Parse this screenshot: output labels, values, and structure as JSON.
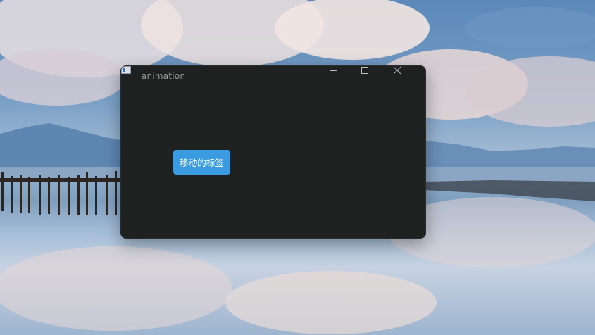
{
  "window": {
    "title": "animation"
  },
  "content": {
    "moving_label": "移动的标签"
  },
  "colors": {
    "window_bg": "#1f2020",
    "label_bg": "#3b9be0",
    "title_text": "#9a9a9a"
  },
  "icons": {
    "app": "app-window-icon",
    "minimize": "minimize-icon",
    "maximize": "maximize-icon",
    "close": "close-icon"
  }
}
